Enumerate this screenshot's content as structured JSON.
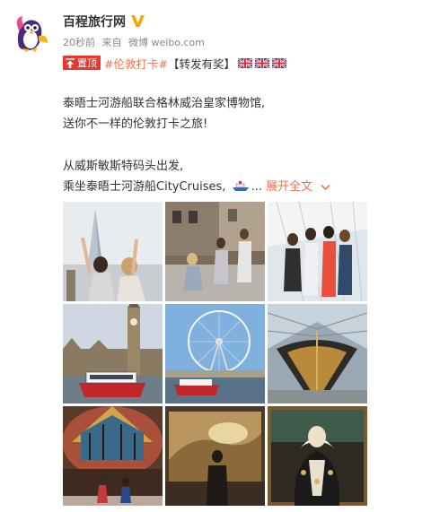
{
  "account": {
    "name": "百程旅行网",
    "verified_icon": "verified-v-icon",
    "time": "20秒前",
    "source_prefix": "来自",
    "source": "微博 weibo.com"
  },
  "post": {
    "pin_label": "置顶",
    "hashtag": "#伦敦打卡#",
    "bracket_text": "【转发有奖】",
    "flag_icons": [
      "uk-flag-icon",
      "uk-flag-icon",
      "uk-flag-icon"
    ],
    "para1_line1": "泰晤士河游船联合格林威治皇家博物馆,",
    "para1_line2": "送你不一样的伦敦打卡之旅!",
    "para2_line1": "从威斯敏斯特码头出发,",
    "para2_line2_text": "乘坐泰晤士河游船CityCruises,",
    "ship_icon": "ship-icon",
    "ellipsis": "...",
    "expand_label": "展开全文",
    "expand_icon": "chevron-down-icon"
  },
  "colors": {
    "accent": "#eb7350",
    "pin_red": "#e8392f",
    "verified": "#ffa500"
  }
}
